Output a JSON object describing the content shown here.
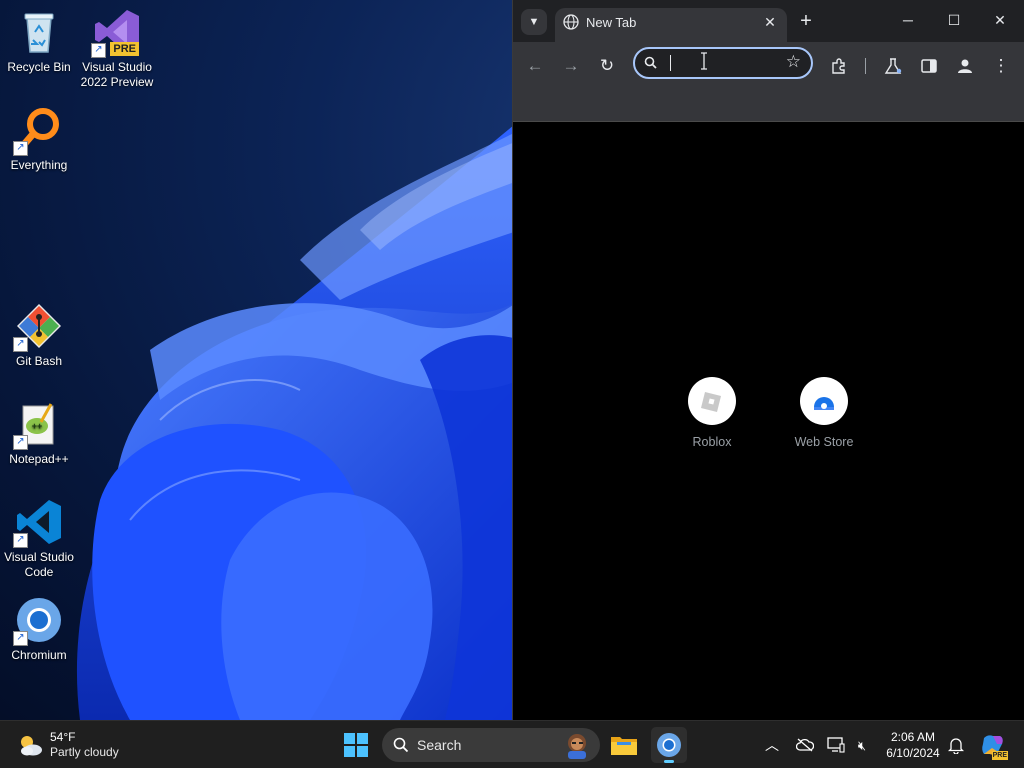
{
  "desktop": {
    "icons": [
      {
        "label": "Recycle Bin",
        "icon": "recycle-bin-icon"
      },
      {
        "label": "Visual Studio 2022 Preview",
        "icon": "visual-studio-preview-icon",
        "badge": "PRE"
      },
      {
        "label": "Everything",
        "icon": "everything-search-icon"
      },
      {
        "label": "Git Bash",
        "icon": "git-bash-icon"
      },
      {
        "label": "Notepad++",
        "icon": "notepadpp-icon"
      },
      {
        "label": "Visual Studio Code",
        "icon": "vscode-icon"
      },
      {
        "label": "Chromium",
        "icon": "chromium-icon"
      }
    ]
  },
  "browser": {
    "tab": {
      "title": "New Tab",
      "icon": "globe-icon"
    },
    "toolbar": {
      "omnibox_value": "",
      "icons": [
        "back-icon",
        "forward-icon",
        "reload-icon",
        "search-icon",
        "bookmark-star-icon",
        "extensions-icon",
        "labs-flask-icon",
        "side-panel-icon",
        "profile-icon",
        "menu-icon"
      ]
    },
    "shortcuts": [
      {
        "label": "Roblox",
        "icon": "roblox-icon"
      },
      {
        "label": "Web Store",
        "icon": "web-store-icon"
      }
    ],
    "window_controls": [
      "minimize-icon",
      "maximize-icon",
      "close-icon"
    ]
  },
  "taskbar": {
    "weather": {
      "temp": "54°F",
      "condition": "Partly cloudy"
    },
    "search_label": "Search",
    "apps": [
      "start-icon",
      "file-explorer-icon",
      "chromium-icon"
    ],
    "tray_icons": [
      "chevron-up-icon",
      "onedrive-icon",
      "display-icon",
      "network-muted-icon",
      "notifications-icon",
      "copilot-icon"
    ],
    "time": "2:06 AM",
    "date": "6/10/2024",
    "copilot_badge": "PRE"
  },
  "colors": {
    "wallpaper_dark": "#06163a",
    "bloom_blue": "#1f52ff",
    "browser_frame": "#202124",
    "toolbar": "#35363a",
    "omnibox_focus": "#a8c7fa",
    "taskbar": "#1f1f1f",
    "accent": "#60cdff"
  }
}
